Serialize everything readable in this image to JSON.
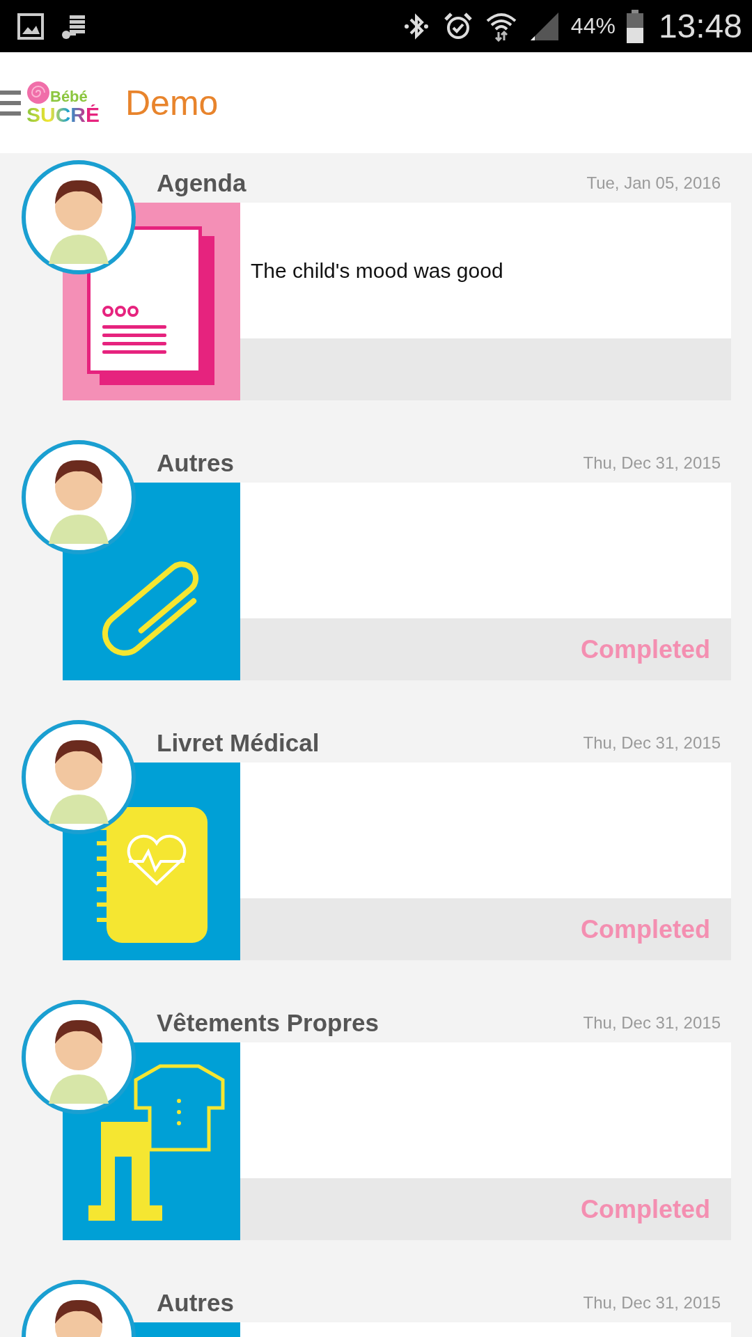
{
  "status_bar": {
    "battery_text": "44%",
    "time": "13:48"
  },
  "header": {
    "logo_top": "Bébé",
    "logo_bottom": "SUCRÉ",
    "title": "Demo"
  },
  "entries": [
    {
      "kind": "agenda",
      "title": "Agenda",
      "date": "Tue, Jan 05, 2016",
      "message": "The child's mood was good"
    },
    {
      "kind": "other",
      "title": "Autres",
      "date": "Thu, Dec 31, 2015",
      "status": "Completed"
    },
    {
      "kind": "medical",
      "title": "Livret Médical",
      "date": "Thu, Dec 31, 2015",
      "status": "Completed"
    },
    {
      "kind": "clothes",
      "title": "Vêtements Propres",
      "date": "Thu, Dec 31, 2015",
      "status": "Completed"
    },
    {
      "kind": "other",
      "title": "Autres",
      "date": "Thu, Dec 31, 2015",
      "partial": true
    }
  ]
}
